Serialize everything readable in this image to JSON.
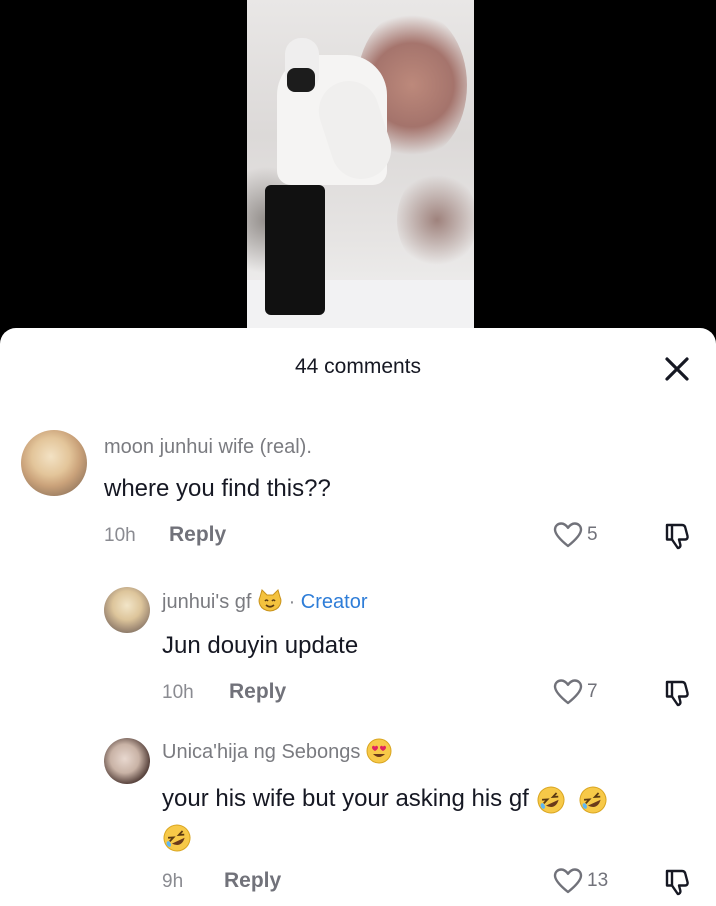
{
  "sheet": {
    "title": "44 comments"
  },
  "comments": [
    {
      "username": "moon junhui wife (real).",
      "text": "where you find this??",
      "time": "10h",
      "reply_label": "Reply",
      "likes": "5"
    },
    {
      "username": "junhui's gf",
      "username_emoji": "cat-face",
      "separator": "·",
      "badge": "Creator",
      "text": "Jun douyin update",
      "time": "10h",
      "reply_label": "Reply",
      "likes": "7"
    },
    {
      "username": "Unica'hija ng Sebongs",
      "username_emoji": "heart-eyes-face",
      "text": "your his wife but your asking his gf",
      "text_emoji": "rolling-laughing-face",
      "time": "9h",
      "reply_label": "Reply",
      "likes": "13"
    }
  ],
  "icons": {
    "close": "close-icon",
    "like": "heart-outline-icon",
    "dislike": "thumbs-down-outline-icon"
  },
  "colors": {
    "creator_badge": "#2e7dd8",
    "text_primary": "#161823",
    "text_secondary": "#71727a"
  }
}
